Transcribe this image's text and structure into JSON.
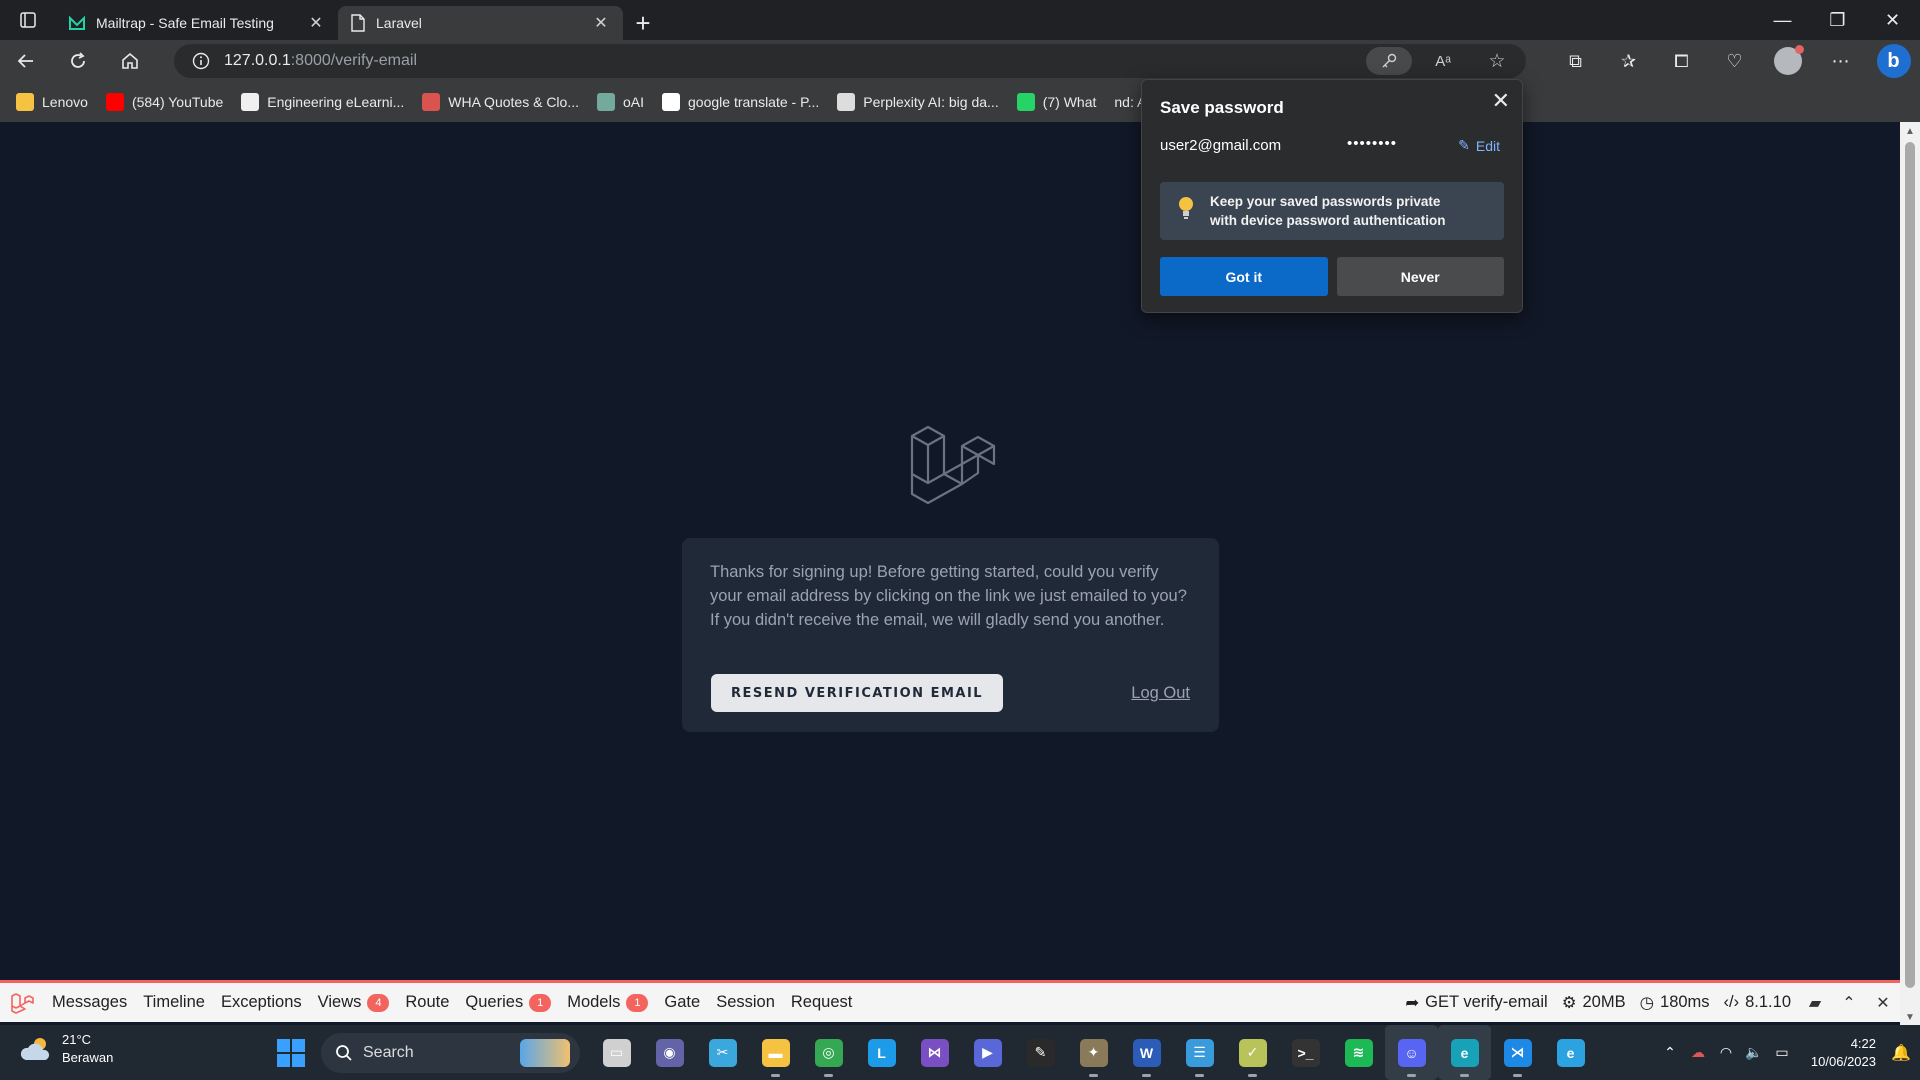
{
  "browser": {
    "tabs": [
      {
        "title": "Mailtrap - Safe Email Testing",
        "active": false
      },
      {
        "title": "Laravel",
        "active": true
      }
    ],
    "address": {
      "host": "127.0.0.1",
      "rest": ":8000/verify-email"
    },
    "bookmarks": [
      {
        "label": "Lenovo",
        "icon": "folder-icon",
        "color": "#f5c242"
      },
      {
        "label": "(584) YouTube",
        "icon": "youtube-icon",
        "color": "#ff0000"
      },
      {
        "label": "Engineering eLearni...",
        "icon": "moodle-icon",
        "color": "#f0f0f0"
      },
      {
        "label": "WHA Quotes & Clo...",
        "icon": "shop-icon",
        "color": "#d9534f"
      },
      {
        "label": "oAI",
        "icon": "openai-icon",
        "color": "#74aa9c"
      },
      {
        "label": "google translate - P...",
        "icon": "google-icon",
        "color": "#ffffff"
      },
      {
        "label": "Perplexity AI: big da...",
        "icon": "grid-icon",
        "color": "#dddddd"
      },
      {
        "label": "(7) What",
        "icon": "whatsapp-icon",
        "color": "#25d366"
      },
      {
        "label": "nd: AI search en...",
        "icon": "",
        "color": ""
      }
    ]
  },
  "popup": {
    "title": "Save password",
    "username": "user2@gmail.com",
    "password_mask": "••••••••",
    "edit_label": "Edit",
    "info_line1": "Keep your saved passwords private",
    "info_line2": "with device password authentication",
    "got_it": "Got it",
    "never": "Never"
  },
  "page": {
    "message": "Thanks for signing up! Before getting started, could you verify your email address by clicking on the link we just emailed to you? If you didn't receive the email, we will gladly send you another.",
    "resend_label": "RESEND VERIFICATION EMAIL",
    "logout_label": "Log Out"
  },
  "debugbar": {
    "tabs": [
      {
        "label": "Messages",
        "badge": null
      },
      {
        "label": "Timeline",
        "badge": null
      },
      {
        "label": "Exceptions",
        "badge": null
      },
      {
        "label": "Views",
        "badge": "4"
      },
      {
        "label": "Route",
        "badge": null
      },
      {
        "label": "Queries",
        "badge": "1"
      },
      {
        "label": "Models",
        "badge": "1"
      },
      {
        "label": "Gate",
        "badge": null
      },
      {
        "label": "Session",
        "badge": null
      },
      {
        "label": "Request",
        "badge": null
      }
    ],
    "request": "GET verify-email",
    "memory": "20MB",
    "time": "180ms",
    "php_version": "8.1.10"
  },
  "taskbar": {
    "weather_temp": "21°C",
    "weather_desc": "Berawan",
    "search_placeholder": "Search",
    "time": "4:22",
    "date": "10/06/2023",
    "apps": [
      {
        "name": "task-view-app-icon",
        "color": "#d0d0d0",
        "glyph": "▭",
        "running": false
      },
      {
        "name": "teams-chat-app-icon",
        "color": "#6264a7",
        "glyph": "◉",
        "running": false
      },
      {
        "name": "snipping-tool-app-icon",
        "color": "#3aa8dc",
        "glyph": "✂",
        "running": false
      },
      {
        "name": "file-explorer-app-icon",
        "color": "#f5c242",
        "glyph": "▬",
        "running": true
      },
      {
        "name": "chrome-app-icon",
        "color": "#34a853",
        "glyph": "◎",
        "running": true
      },
      {
        "name": "l-app-icon",
        "color": "#1e9be8",
        "glyph": "L",
        "running": false
      },
      {
        "name": "visual-studio-app-icon",
        "color": "#7b4fc4",
        "glyph": "⋈",
        "running": false
      },
      {
        "name": "power-automate-app-icon",
        "color": "#5a67d8",
        "glyph": "▶",
        "running": false
      },
      {
        "name": "inkscape-app-icon",
        "color": "#2a2a2a",
        "glyph": "✎",
        "running": false
      },
      {
        "name": "gimp-app-icon",
        "color": "#8a7a5a",
        "glyph": "✦",
        "running": true
      },
      {
        "name": "word-app-icon",
        "color": "#2b5cb8",
        "glyph": "W",
        "running": true
      },
      {
        "name": "notepad-app-icon",
        "color": "#3a9bdc",
        "glyph": "☰",
        "running": true
      },
      {
        "name": "sticky-notes-app-icon",
        "color": "#b8c45a",
        "glyph": "✓",
        "running": true
      },
      {
        "name": "terminal-app-icon",
        "color": "#333333",
        "glyph": ">_",
        "running": false
      },
      {
        "name": "spotify-app-icon",
        "color": "#1db954",
        "glyph": "≋",
        "running": false
      },
      {
        "name": "discord-app-icon",
        "color": "#5865f2",
        "glyph": "☺",
        "running": true,
        "focused": true
      },
      {
        "name": "edge-app-icon",
        "color": "#17a2b8",
        "glyph": "e",
        "running": true,
        "focused": true
      },
      {
        "name": "vscode-app-icon",
        "color": "#1e88e5",
        "glyph": "⋊",
        "running": true
      },
      {
        "name": "edge-dev-app-icon",
        "color": "#2ca3e0",
        "glyph": "e",
        "running": false
      }
    ]
  }
}
